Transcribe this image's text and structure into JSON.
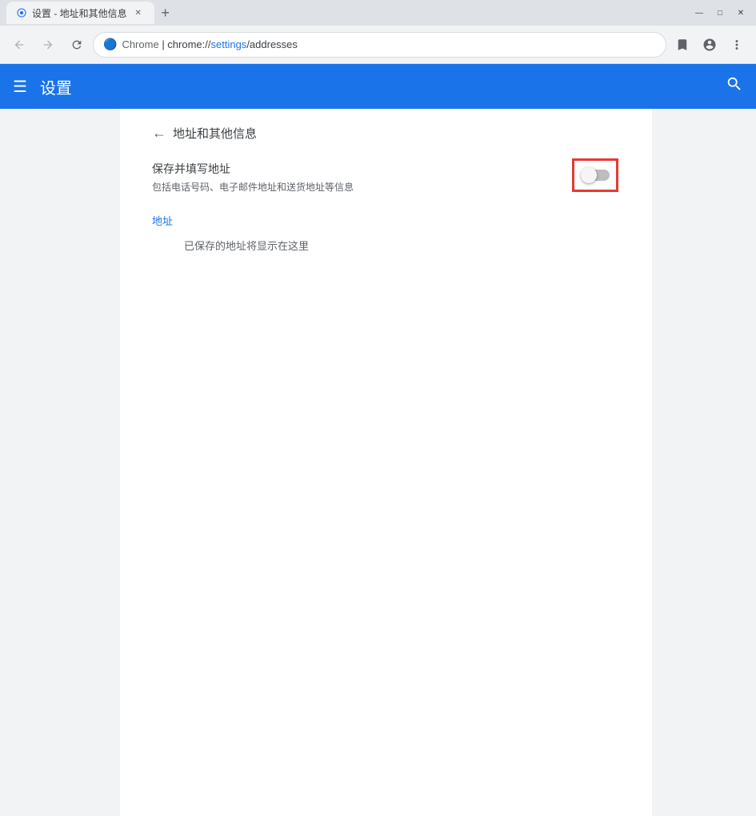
{
  "titlebar": {
    "tab_title": "设置 - 地址和其他信息",
    "new_tab_label": "+",
    "controls": {
      "minimize": "—",
      "maximize": "□",
      "close": "✕"
    }
  },
  "toolbar": {
    "back_tooltip": "后退",
    "forward_tooltip": "前进",
    "refresh_tooltip": "刷新",
    "address": {
      "chrome_text": "Chrome",
      "separator": " | ",
      "url": "chrome://settings/addresses"
    },
    "bookmark_tooltip": "为此标签页添加书签",
    "account_tooltip": "账号",
    "menu_tooltip": "自定义及控制 Google Chrome"
  },
  "header": {
    "title": "设置",
    "menu_label": "☰",
    "search_label": "🔍"
  },
  "page": {
    "back_label": "←",
    "page_title": "地址和其他信息",
    "save_label": "保存并填写地址",
    "save_desc": "包括电话号码、电子邮件地址和送货地址等信息",
    "section_title": "地址",
    "empty_msg": "已保存的地址将显示在这里"
  }
}
